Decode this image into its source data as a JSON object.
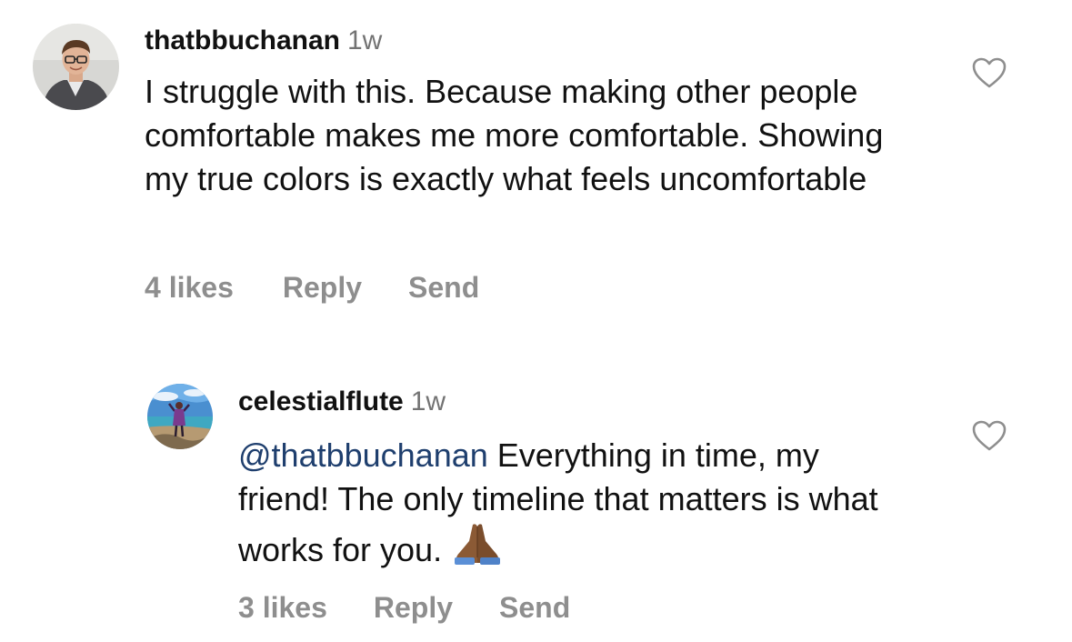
{
  "comments": [
    {
      "username": "thatbbuchanan",
      "age": "1w",
      "text": "I struggle with this. Because making other people comfortable makes me more comfortable. Showing my true colors is exactly what feels uncomfortable",
      "likes": "4 likes",
      "reply_label": "Reply",
      "send_label": "Send"
    },
    {
      "username": "celestialflute",
      "age": "1w",
      "mention": "@thatbbuchanan",
      "text": " Everything in time, my friend! The only timeline that matters is what works for you.",
      "likes": "3 likes",
      "reply_label": "Reply",
      "send_label": "Send"
    }
  ],
  "icons": {
    "like": "heart-outline-icon",
    "emoji": "folded-hands-emoji"
  },
  "colors": {
    "text": "#111111",
    "secondary": "#8e8e8e",
    "mention": "#1f3f6e"
  }
}
